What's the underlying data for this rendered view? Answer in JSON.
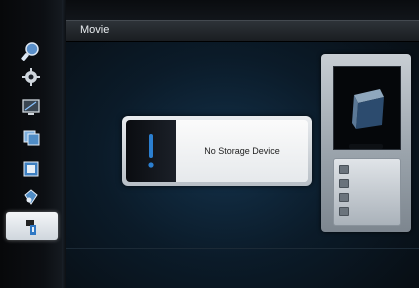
{
  "header": {
    "title": "Movie"
  },
  "dialog": {
    "message": "No Storage Device",
    "icon": "exclamation-icon"
  },
  "sidebar": {
    "items": [
      {
        "icon": "search-icon"
      },
      {
        "icon": "settings-gear-icon"
      },
      {
        "icon": "monitor-icon"
      },
      {
        "icon": "photos-icon"
      },
      {
        "icon": "film-icon"
      },
      {
        "icon": "music-icon"
      },
      {
        "icon": "usb-storage-icon",
        "selected": true
      }
    ]
  },
  "preview": {
    "list_icons": [
      "file-icon",
      "music-note-icon",
      "film-icon",
      "image-icon"
    ]
  },
  "colors": {
    "accent": "#2a7fc9",
    "dialog_bg": "#f6f7f8",
    "title_bar": "#2e3338"
  }
}
